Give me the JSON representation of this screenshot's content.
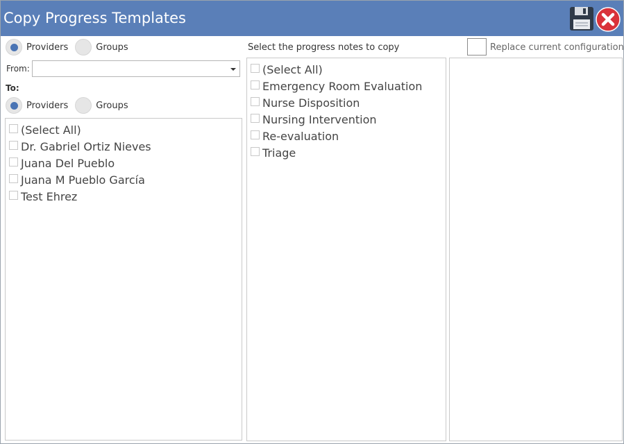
{
  "window": {
    "title": "Copy Progress Templates"
  },
  "source": {
    "provider_label": "Providers",
    "group_label": "Groups",
    "selected": "Providers",
    "from_label": "From:",
    "from_value": ""
  },
  "target": {
    "to_label": "To:",
    "provider_label": "Providers",
    "group_label": "Groups",
    "selected": "Providers",
    "items": [
      {
        "label": "(Select All)",
        "checked": false
      },
      {
        "label": "Dr. Gabriel Ortiz Nieves",
        "checked": false
      },
      {
        "label": "Juana Del Pueblo",
        "checked": false
      },
      {
        "label": "Juana M Pueblo García",
        "checked": false
      },
      {
        "label": "Test Ehrez",
        "checked": false
      }
    ]
  },
  "notes": {
    "heading": "Select the progress notes to copy",
    "items": [
      {
        "label": "(Select All)",
        "checked": false
      },
      {
        "label": "Emergency Room Evaluation",
        "checked": false
      },
      {
        "label": "Nurse Disposition",
        "checked": false
      },
      {
        "label": "Nursing Intervention",
        "checked": false
      },
      {
        "label": "Re-evaluation",
        "checked": false
      },
      {
        "label": "Triage",
        "checked": false
      }
    ]
  },
  "options": {
    "replace_label": "Replace current configuration",
    "replace_checked": false
  },
  "icons": {
    "save": "floppy-disk-icon",
    "close": "close-x-icon"
  },
  "colors": {
    "titlebar": "#5a7fb8",
    "radio_dot": "#4a74b4",
    "close_red": "#d9323a"
  }
}
